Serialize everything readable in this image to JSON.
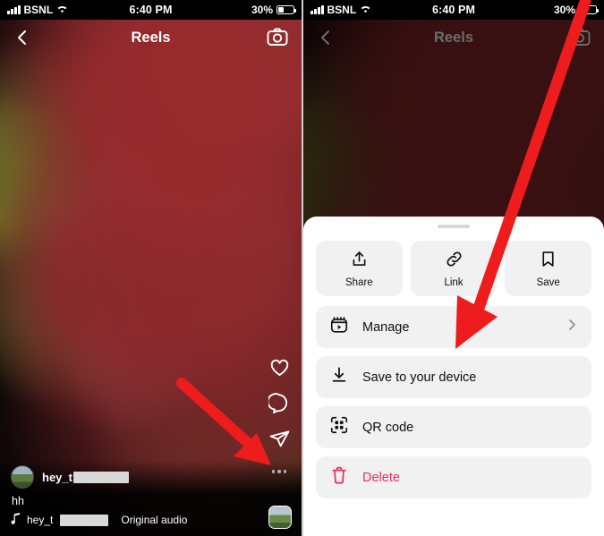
{
  "status_bar": {
    "carrier": "BSNL",
    "wifi_icon": "wifi-icon",
    "time": "6:40 PM",
    "battery_percent": "30%",
    "battery_icon": "battery-icon",
    "signal_icon": "cellular-signal-icon"
  },
  "left_panel": {
    "nav": {
      "back_icon": "chevron-left-icon",
      "title": "Reels",
      "camera_icon": "camera-icon"
    },
    "actions": {
      "like_icon": "heart-icon",
      "comment_icon": "comment-bubble-icon",
      "share_icon": "paper-plane-icon",
      "more_icon": "more-options-icon"
    },
    "post": {
      "username": "hey_t",
      "username_redacted": true,
      "caption": "hh",
      "audio_note_icon": "music-note-icon",
      "audio_owner": "hey_t",
      "audio_label": "Original audio",
      "thumbnail_icon": "audio-cover-thumbnail"
    }
  },
  "right_panel": {
    "nav": {
      "back_icon": "chevron-left-icon",
      "title": "Reels",
      "camera_icon": "camera-icon"
    },
    "sheet": {
      "grabber": "drag-handle",
      "quick_actions": [
        {
          "label": "Share",
          "icon": "share-up-arrow-icon"
        },
        {
          "label": "Link",
          "icon": "link-chain-icon"
        },
        {
          "label": "Save",
          "icon": "bookmark-icon"
        }
      ],
      "rows": [
        {
          "label": "Manage",
          "icon": "reels-manage-icon",
          "chevron": "chevron-right-icon",
          "danger": false
        },
        {
          "label": "Save to your device",
          "icon": "download-icon",
          "chevron": "",
          "danger": false
        },
        {
          "label": "QR code",
          "icon": "qr-code-icon",
          "chevron": "",
          "danger": false
        },
        {
          "label": "Delete",
          "icon": "trash-icon",
          "chevron": "",
          "danger": true
        }
      ]
    }
  },
  "annotations": {
    "arrow_color": "#ee1c1c",
    "left_arrow_target": "more-options-icon",
    "right_arrow_target": "Manage"
  },
  "colors": {
    "accent_red": "#ee1c1c",
    "delete_pink": "#ed2a5b",
    "sheet_bg": "#ffffff",
    "row_bg": "#f1f1f2"
  }
}
